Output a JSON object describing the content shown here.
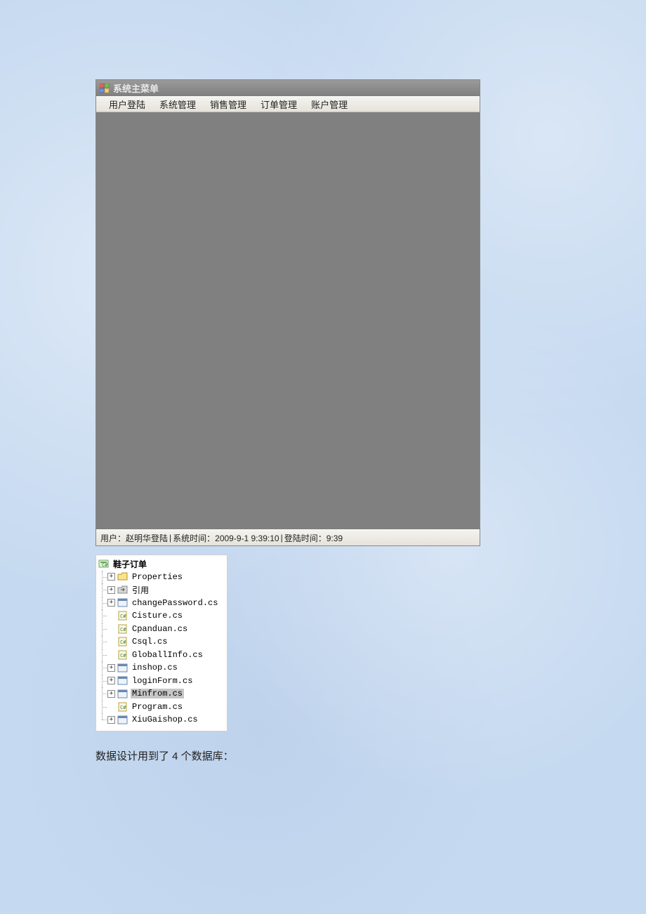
{
  "window": {
    "title": "系统主菜单",
    "menu": [
      "用户登陆",
      "系统管理",
      "销售管理",
      "订单管理",
      "账户管理"
    ],
    "status": {
      "user": "用户：赵明华登陆",
      "sep1": "  |  ",
      "systime": "系统时间：2009-9-1 9:39:10",
      "sep2": "   |",
      "logintime": "登陆时间：9:39"
    }
  },
  "tree": {
    "root": "鞋子订单",
    "items": [
      {
        "label": "Properties",
        "expandable": true,
        "icon": "folder"
      },
      {
        "label": "引用",
        "expandable": true,
        "icon": "ref"
      },
      {
        "label": "changePassword.cs",
        "expandable": true,
        "icon": "form"
      },
      {
        "label": "Cisture.cs",
        "expandable": false,
        "icon": "cs"
      },
      {
        "label": "Cpanduan.cs",
        "expandable": false,
        "icon": "cs"
      },
      {
        "label": "Csql.cs",
        "expandable": false,
        "icon": "cs"
      },
      {
        "label": "GloballInfo.cs",
        "expandable": false,
        "icon": "cs"
      },
      {
        "label": "inshop.cs",
        "expandable": true,
        "icon": "form"
      },
      {
        "label": "loginForm.cs",
        "expandable": true,
        "icon": "form"
      },
      {
        "label": "Minfrom.cs",
        "expandable": true,
        "icon": "form",
        "selected": true
      },
      {
        "label": "Program.cs",
        "expandable": false,
        "icon": "cs"
      },
      {
        "label": "XiuGaishop.cs",
        "expandable": true,
        "icon": "form",
        "last": true
      }
    ]
  },
  "body_text": "数据设计用到了 4 个数据库："
}
